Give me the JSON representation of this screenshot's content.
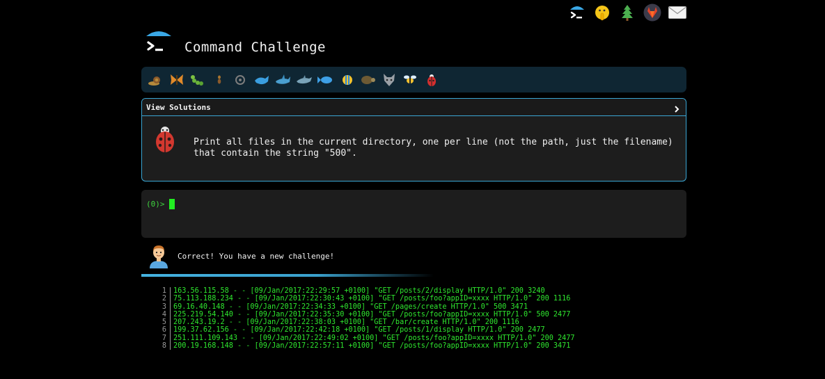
{
  "header": {
    "title": "Command Challenge"
  },
  "top_icons": [
    {
      "name": "terminal-umbrella-icon"
    },
    {
      "name": "shush-face-icon"
    },
    {
      "name": "pine-tree-icon"
    },
    {
      "name": "gitlab-icon"
    },
    {
      "name": "mail-icon"
    }
  ],
  "progress_icons": [
    "snail-icon",
    "butterfly-icon",
    "caterpillar-icon",
    "ant-icon",
    "wheel-icon",
    "whale-icon",
    "shark-icon",
    "dolphin-icon",
    "fish-icon",
    "tropical-fish-icon",
    "turtle-icon",
    "wolf-icon",
    "bee-icon",
    "ladybug-icon"
  ],
  "challenge": {
    "header_label": "View Solutions",
    "description": "Print all files in the current directory, one per line (not the path, just the filename)\nthat contain the string \"500\"."
  },
  "terminal": {
    "prompt": "(0)>"
  },
  "feedback": {
    "message": "Correct! You have a new challenge!"
  },
  "log_lines": [
    {
      "n": "1",
      "text": "163.56.115.58 - - [09/Jan/2017:22:29:57 +0100] \"GET /posts/2/display HTTP/1.0\" 200 3240"
    },
    {
      "n": "2",
      "text": "75.113.188.234 - - [09/Jan/2017:22:30:43 +0100] \"GET /posts/foo?appID=xxxx HTTP/1.0\" 200 1116"
    },
    {
      "n": "3",
      "text": "69.16.40.148 - - [09/Jan/2017:22:34:33 +0100] \"GET /pages/create HTTP/1.0\" 500 3471"
    },
    {
      "n": "4",
      "text": "225.219.54.140 - - [09/Jan/2017:22:35:30 +0100] \"GET /posts/foo?appID=xxxx HTTP/1.0\" 500 2477"
    },
    {
      "n": "5",
      "text": "207.243.19.2 - - [09/Jan/2017:22:38:03 +0100] \"GET /bar/create HTTP/1.0\" 200 1116"
    },
    {
      "n": "6",
      "text": "199.37.62.156 - - [09/Jan/2017:22:42:18 +0100] \"GET /posts/1/display HTTP/1.0\" 200 2477"
    },
    {
      "n": "7",
      "text": "251.111.109.143 - - [09/Jan/2017:22:49:02 +0100] \"GET /posts/foo?appID=xxxx HTTP/1.0\" 200 2477"
    },
    {
      "n": "8",
      "text": "200.19.168.148 - - [09/Jan/2017:22:57:11 +0100] \"GET /posts/foo?appID=xxxx HTTP/1.0\" 200 3471"
    }
  ]
}
